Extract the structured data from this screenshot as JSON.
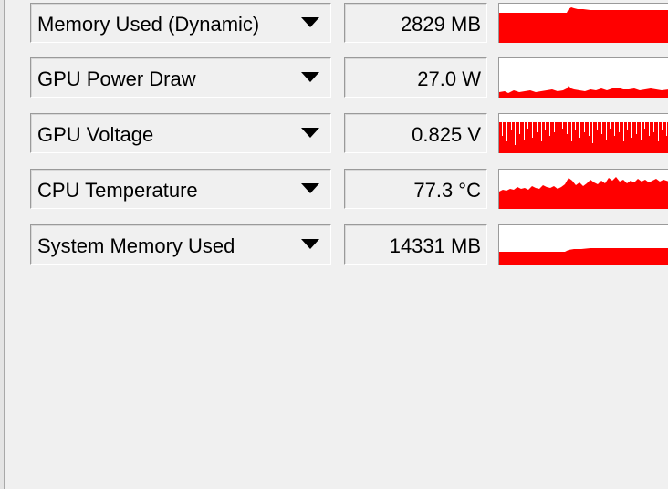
{
  "sensors": [
    {
      "label": "Memory Used (Dynamic)",
      "value": "2829 MB"
    },
    {
      "label": "GPU Power Draw",
      "value": "27.0 W"
    },
    {
      "label": "GPU Voltage",
      "value": "0.825 V"
    },
    {
      "label": "CPU Temperature",
      "value": "77.3 °C"
    },
    {
      "label": "System Memory Used",
      "value": "14331 MB"
    }
  ],
  "colors": {
    "graph_fill": "#ff0000",
    "graph_background": "#ffffff",
    "panel_background": "#f0f0f0"
  },
  "icons": {
    "dropdown": "chevron-down-icon"
  }
}
